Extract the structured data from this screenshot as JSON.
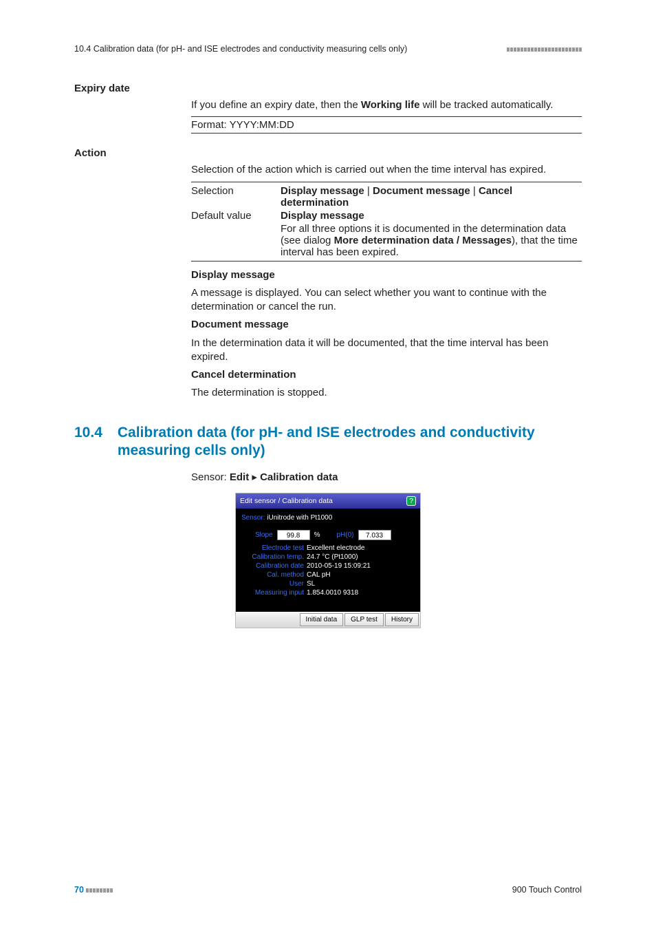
{
  "header_left": "10.4 Calibration data (for pH- and ISE electrodes and conductivity measuring cells only)",
  "sec1": {
    "label": "Expiry date",
    "intro_a": "If you define an expiry date, then the ",
    "intro_bold": "Working life",
    "intro_b": " will be tracked automatically.",
    "format": "Format: YYYY:MM:DD"
  },
  "sec2": {
    "label": "Action",
    "intro": "Selection of the action which is carried out when the time interval has expired.",
    "sel_k": "Selection",
    "sel_v_a": "Display message",
    "sel_v_b": "Document message",
    "sel_v_c": "Cancel determination",
    "separator": " | ",
    "def_k": "Default value",
    "def_v": "Display message",
    "note_a": "For all three options it is documented in the determination data (see dialog ",
    "note_bold": "More determination data / Messages",
    "note_b": "), that the time interval has been expired.",
    "opt1_h": "Display message",
    "opt1_t": "A message is displayed. You can select whether you want to continue with the determination or cancel the run.",
    "opt2_h": "Document message",
    "opt2_t": "In the determination data it will be documented, that the time interval has been expired.",
    "opt3_h": "Cancel determination",
    "opt3_t": "The determination is stopped."
  },
  "h2": {
    "num": "10.4",
    "text": "Calibration data (for pH- and ISE electrodes and conductivity measuring cells only)"
  },
  "bc_a": "Sensor: ",
  "bc_b": "Edit",
  "bc_sep": " ▸ ",
  "bc_c": "Calibration data",
  "dlg": {
    "title": "Edit sensor / Calibration data",
    "sensor_lbl": "Sensor:",
    "sensor_val": "iUnitrode with Pt1000",
    "slope_lbl": "Slope",
    "slope_val": "99.8",
    "slope_unit": "%",
    "ph0_lbl": "pH(0)",
    "ph0_val": "7.033",
    "etest_lbl": "Electrode test",
    "etest_val": "Excellent electrode",
    "ctemp_lbl": "Calibration temp.",
    "ctemp_val": "24.7 °C   (Pt1000)",
    "cdate_lbl": "Calibration date",
    "cdate_val": "2010-05-19 15:09:21",
    "cmeth_lbl": "Cal. method",
    "cmeth_val": "CAL pH",
    "user_lbl": "User",
    "user_val": "SL",
    "mi_lbl": "Measuring input",
    "mi_val": "1.854.0010 9318",
    "btn1": "Initial data",
    "btn2": "GLP test",
    "btn3": "History"
  },
  "footer": {
    "page": "70",
    "title": "900 Touch Control"
  }
}
